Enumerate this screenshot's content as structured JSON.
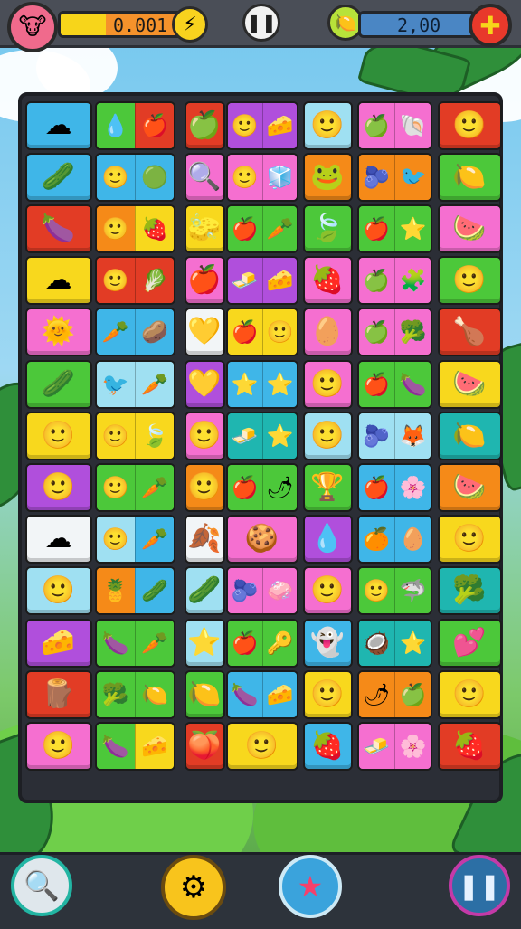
{
  "hud": {
    "score": "0.001",
    "coins": "2,00",
    "score_icon": "bull-head-icon",
    "hint_icon": "lightning-coin-icon",
    "pause_icon": "pause-icon",
    "coin_icon": "lemon-coin-icon",
    "add_icon": "plus-icon"
  },
  "bottom_bar": {
    "buttons": [
      {
        "name": "search-button",
        "icon": "magnifier-icon"
      },
      {
        "name": "shuffle-button",
        "icon": "gold-gear-coin-icon"
      },
      {
        "name": "star-powerup-button",
        "icon": "star-icon"
      },
      {
        "name": "pause-button-bottom",
        "icon": "pause-icon"
      }
    ]
  },
  "colors": {
    "blue": "#3fb6e8",
    "green": "#4cc83a",
    "red": "#e23c25",
    "pink": "#f56fd0",
    "yellow": "#f8d81d",
    "orange": "#f58a18",
    "purple": "#b04fdc",
    "lightblue": "#9fe0f2",
    "white": "#f2f5f7",
    "teal": "#1fb6b0",
    "lime": "#8ed43a"
  },
  "board": {
    "rows": [
      [
        [
          "blue",
          "☁"
        ],
        [
          "green",
          "💧",
          "red",
          "🍎"
        ],
        [
          "red",
          "🍏"
        ],
        [
          "purple",
          "🙂",
          "purple",
          "🧀"
        ],
        [
          "lightblue",
          "🙂"
        ],
        [
          "pink",
          "🍏",
          "pink",
          "🐚"
        ],
        [
          "red",
          "🙂"
        ]
      ],
      [
        [
          "blue",
          "🥒"
        ],
        [
          "blue",
          "🙂",
          "blue",
          "🟢"
        ],
        [
          "pink",
          "🔍"
        ],
        [
          "pink",
          "🙂",
          "pink",
          "🧊"
        ],
        [
          "orange",
          "🐸"
        ],
        [
          "orange",
          "🫐",
          "orange",
          "🐦"
        ],
        [
          "green",
          "🍋"
        ]
      ],
      [
        [
          "red",
          "🍆"
        ],
        [
          "orange",
          "🙂",
          "yellow",
          "🍓"
        ],
        [
          "yellow",
          "🧽"
        ],
        [
          "green",
          "🍎",
          "green",
          "🥕"
        ],
        [
          "green",
          "🍃"
        ],
        [
          "green",
          "🍎",
          "green",
          "⭐"
        ],
        [
          "pink",
          "🍉"
        ]
      ],
      [
        [
          "yellow",
          "☁"
        ],
        [
          "red",
          "🙂",
          "red",
          "🥬"
        ],
        [
          "pink",
          "🍎"
        ],
        [
          "purple",
          "🧈",
          "purple",
          "🧀"
        ],
        [
          "pink",
          "🍓"
        ],
        [
          "pink",
          "🍏",
          "pink",
          "🧩"
        ],
        [
          "green",
          "🙂"
        ]
      ],
      [
        [
          "pink",
          "🌞"
        ],
        [
          "blue",
          "🥕",
          "blue",
          "🥔"
        ],
        [
          "white",
          "💛"
        ],
        [
          "yellow",
          "🍎",
          "yellow",
          "🙂"
        ],
        [
          "pink",
          "🥚"
        ],
        [
          "pink",
          "🍏",
          "pink",
          "🥦"
        ],
        [
          "red",
          "🍗"
        ]
      ],
      [
        [
          "green",
          "🥒"
        ],
        [
          "lightblue",
          "🐦",
          "lightblue",
          "🥕"
        ],
        [
          "purple",
          "💛"
        ],
        [
          "blue",
          "⭐",
          "blue",
          "⭐"
        ],
        [
          "pink",
          "🙂"
        ],
        [
          "green",
          "🍎",
          "green",
          "🍆"
        ],
        [
          "yellow",
          "🍉"
        ]
      ],
      [
        [
          "yellow",
          "🙂"
        ],
        [
          "yellow",
          "🙂",
          "yellow",
          "🍃"
        ],
        [
          "pink",
          "🙂"
        ],
        [
          "teal",
          "🧈",
          "teal",
          "⭐"
        ],
        [
          "lightblue",
          "🙂"
        ],
        [
          "lightblue",
          "🫐",
          "lightblue",
          "🦊"
        ],
        [
          "teal",
          "🍋"
        ]
      ],
      [
        [
          "purple",
          "🙂"
        ],
        [
          "green",
          "🙂",
          "green",
          "🥕"
        ],
        [
          "orange",
          "🙂"
        ],
        [
          "green",
          "🍎",
          "green",
          "🌶"
        ],
        [
          "green",
          "🏆"
        ],
        [
          "blue",
          "🍎",
          "blue",
          "🌸"
        ],
        [
          "orange",
          "🍉"
        ]
      ],
      [
        [
          "white",
          "☁"
        ],
        [
          "lightblue",
          "🙂",
          "blue",
          "🥕"
        ],
        [
          "white",
          "🍂"
        ],
        [
          "pink",
          "🍪"
        ],
        [
          "purple",
          "💧"
        ],
        [
          "blue",
          "🍊",
          "blue",
          "🥚"
        ],
        [
          "yellow",
          "🙂"
        ]
      ],
      [
        [
          "lightblue",
          "🙂"
        ],
        [
          "orange",
          "🍍",
          "blue",
          "🥒"
        ],
        [
          "lightblue",
          "🥒"
        ],
        [
          "pink",
          "🫐",
          "pink",
          "🧼"
        ],
        [
          "pink",
          "🙂"
        ],
        [
          "green",
          "🙂",
          "green",
          "🦈"
        ],
        [
          "teal",
          "🥦"
        ]
      ],
      [
        [
          "purple",
          "🧀"
        ],
        [
          "green",
          "🍆",
          "green",
          "🥕"
        ],
        [
          "lightblue",
          "⭐"
        ],
        [
          "green",
          "🍎",
          "green",
          "🔑"
        ],
        [
          "blue",
          "👻"
        ],
        [
          "teal",
          "🥥",
          "teal",
          "⭐"
        ],
        [
          "green",
          "💕"
        ]
      ],
      [
        [
          "red",
          "🪵"
        ],
        [
          "green",
          "🥦",
          "green",
          "🍋"
        ],
        [
          "green",
          "🍋"
        ],
        [
          "blue",
          "🍆",
          "blue",
          "🧀"
        ],
        [
          "yellow",
          "🙂"
        ],
        [
          "orange",
          "🌶",
          "orange",
          "🍏"
        ],
        [
          "yellow",
          "🙂"
        ]
      ],
      [
        [
          "pink",
          "🙂"
        ],
        [
          "green",
          "🍆",
          "yellow",
          "🧀"
        ],
        [
          "red",
          "🍑"
        ],
        [
          "yellow",
          "🙂"
        ],
        [
          "blue",
          "🍓"
        ],
        [
          "pink",
          "🧈",
          "pink",
          "🌸"
        ],
        [
          "red",
          "🍓"
        ]
      ]
    ]
  }
}
